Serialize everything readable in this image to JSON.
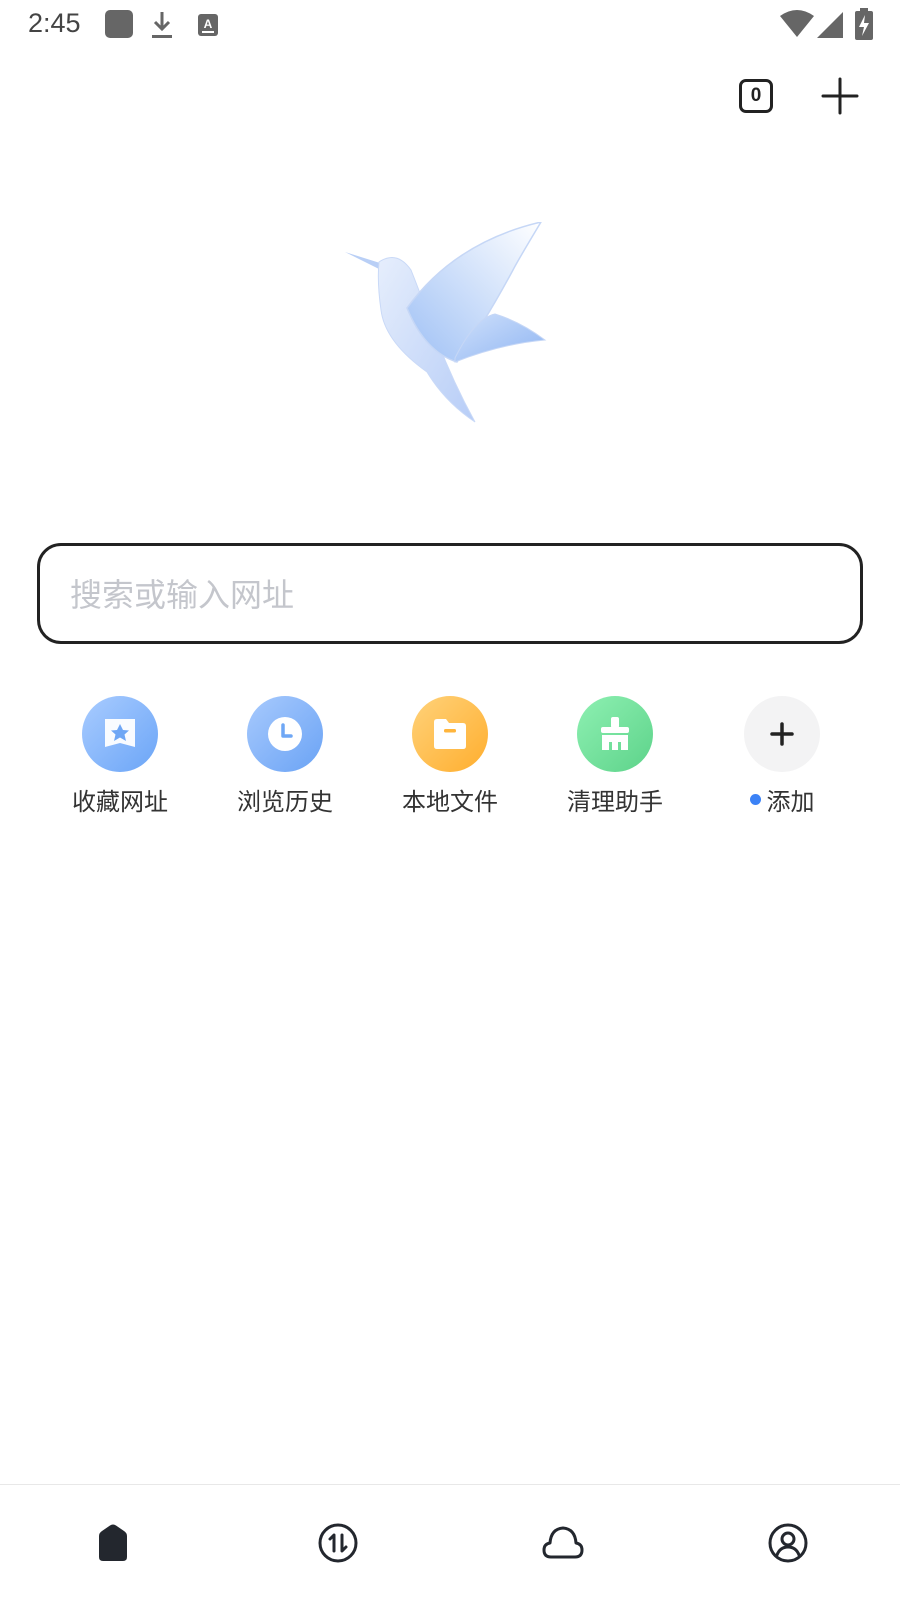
{
  "status_bar": {
    "time": "2:45",
    "icons": [
      "app-square-icon",
      "download-icon",
      "keyboard-a-icon",
      "wifi-icon",
      "signal-icon",
      "battery-charging-icon"
    ]
  },
  "top_bar": {
    "tab_count": "0",
    "new_tab_icon": "plus-icon"
  },
  "logo": {
    "icon": "hummingbird-logo-icon"
  },
  "search": {
    "placeholder": "搜索或输入网址"
  },
  "quick_links": [
    {
      "label": "收藏网址",
      "icon": "bookmark-star-icon",
      "color": "#7fb3fb"
    },
    {
      "label": "浏览历史",
      "icon": "clock-icon",
      "color": "#7eb0f8"
    },
    {
      "label": "本地文件",
      "icon": "folder-icon",
      "color": "#ffbb45"
    },
    {
      "label": "清理助手",
      "icon": "broom-icon",
      "color": "#6fdc95"
    },
    {
      "label": "添加",
      "icon": "plus-icon",
      "color": "#f3f3f4",
      "has_new_dot": true
    }
  ],
  "bottom_nav": [
    {
      "name": "home",
      "icon": "home-icon"
    },
    {
      "name": "transfer",
      "icon": "transfer-icon"
    },
    {
      "name": "cloud",
      "icon": "cloud-icon"
    },
    {
      "name": "profile",
      "icon": "user-icon"
    }
  ],
  "colors": {
    "accent_dot": "#3b82f6",
    "text_primary": "#222222",
    "placeholder": "#c4c6cc"
  }
}
